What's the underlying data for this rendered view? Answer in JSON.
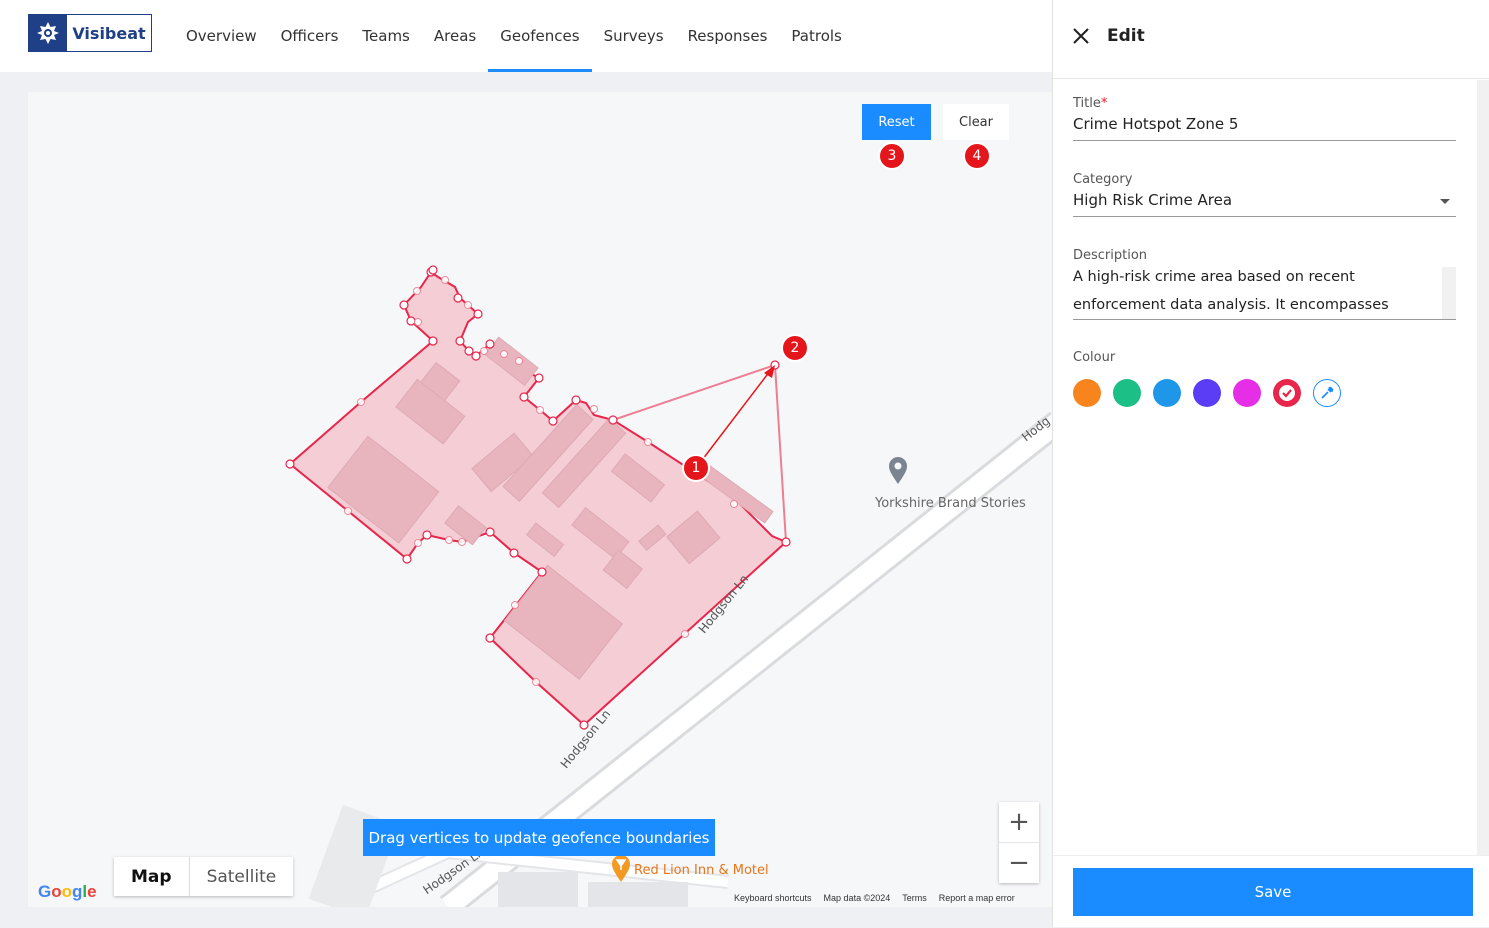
{
  "app": {
    "name": "Visibeat"
  },
  "nav": {
    "items": [
      {
        "label": "Overview"
      },
      {
        "label": "Officers"
      },
      {
        "label": "Teams"
      },
      {
        "label": "Areas"
      },
      {
        "label": "Geofences",
        "active": true
      },
      {
        "label": "Surveys"
      },
      {
        "label": "Responses"
      },
      {
        "label": "Patrols"
      }
    ]
  },
  "map": {
    "reset_label": "Reset",
    "clear_label": "Clear",
    "steps": [
      "1",
      "2",
      "3",
      "4"
    ],
    "hint": "Drag vertices to update geofence boundaries",
    "map_type": {
      "map": "Map",
      "satellite": "Satellite"
    },
    "zoom_in": "+",
    "zoom_out": "−",
    "poi": {
      "yorkshire": "Yorkshire Brand Stories",
      "red_lion": "Red Lion Inn & Motel"
    },
    "roads": {
      "r1": "Hodgson Ln",
      "r2": "Hodgson Ln",
      "r3": "Hodgson Ln",
      "r4": "Hodg"
    },
    "attribution": {
      "shortcuts": "Keyboard shortcuts",
      "data": "Map data ©2024",
      "terms": "Terms",
      "report": "Report a map error"
    },
    "google": [
      "G",
      "o",
      "o",
      "g",
      "l",
      "e"
    ],
    "polygon_color": "#e8254a",
    "polygon_fill": "#f5c6cf"
  },
  "panel": {
    "title": "Edit",
    "fields": {
      "title_label": "Title",
      "title_required": "*",
      "title_value": "Crime Hotspot Zone 5",
      "category_label": "Category",
      "category_value": "High Risk Crime Area",
      "description_label": "Description",
      "description_value": "A high-risk crime area based on recent enforcement data analysis. It encompasses",
      "colour_label": "Colour"
    },
    "colours": [
      "#f7841d",
      "#1cbf85",
      "#1e97e9",
      "#5a3df5",
      "#e62ee6",
      "#e8254a"
    ],
    "selected_colour": "#e8254a",
    "save_label": "Save"
  }
}
